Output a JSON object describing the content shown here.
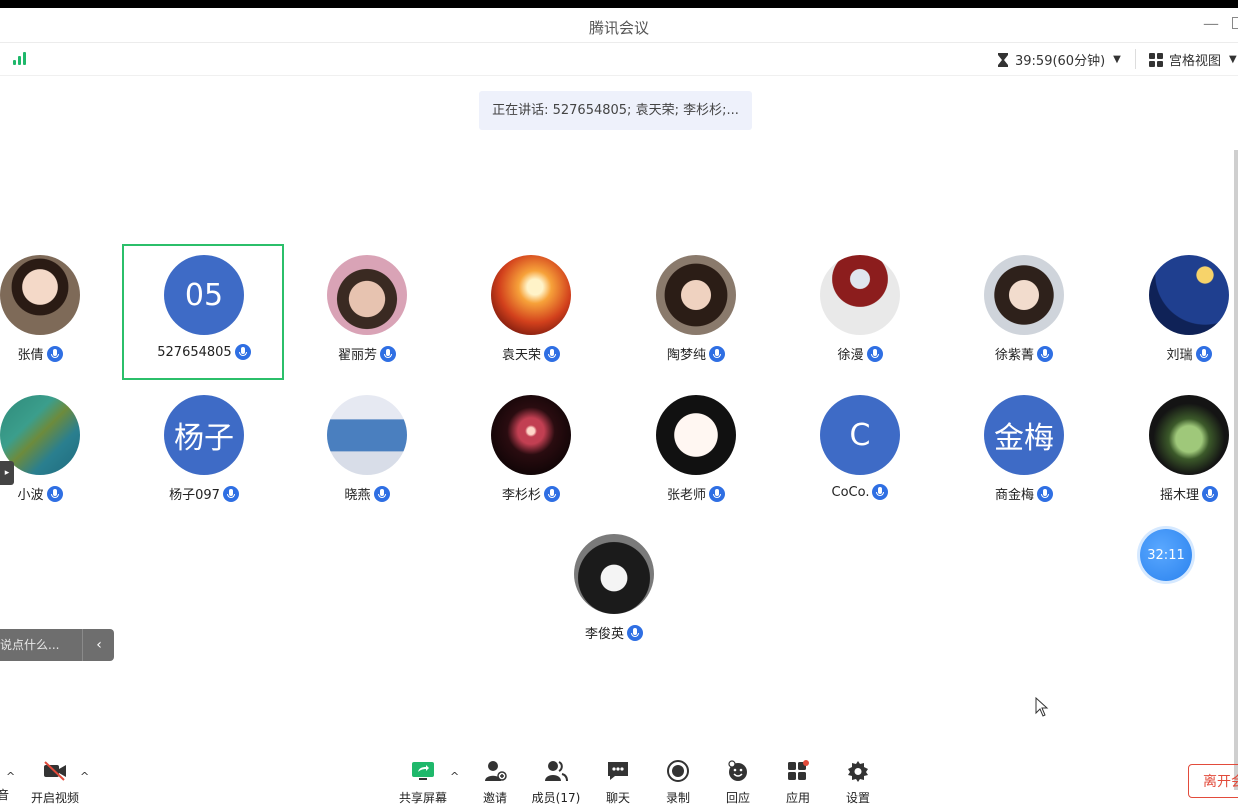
{
  "window": {
    "title": "腾讯会议"
  },
  "toolbar": {
    "timer": "39:59(60分钟)",
    "view_label": "宫格视图"
  },
  "speaking_banner": "正在讲话: 527654805; 袁天荣; 李杉杉;...",
  "participants": [
    {
      "name": "张倩",
      "avatar": "photo"
    },
    {
      "name": "527654805",
      "avatar": "initials",
      "initials": "05",
      "active": true
    },
    {
      "name": "翟丽芳",
      "avatar": "photo"
    },
    {
      "name": "袁天荣",
      "avatar": "photo"
    },
    {
      "name": "陶梦纯",
      "avatar": "photo"
    },
    {
      "name": "徐漫",
      "avatar": "photo"
    },
    {
      "name": "徐紫菁",
      "avatar": "photo"
    },
    {
      "name": "刘瑞",
      "avatar": "photo"
    },
    {
      "name": "小波",
      "avatar": "photo"
    },
    {
      "name": "杨子097",
      "avatar": "initials",
      "initials": "杨子"
    },
    {
      "name": "晓燕",
      "avatar": "photo"
    },
    {
      "name": "李杉杉",
      "avatar": "photo"
    },
    {
      "name": "张老师",
      "avatar": "photo"
    },
    {
      "name": "CoCo.",
      "avatar": "initials",
      "initials": "C"
    },
    {
      "name": "商金梅",
      "avatar": "initials",
      "initials": "金梅"
    },
    {
      "name": "摇木理",
      "avatar": "photo"
    },
    {
      "name": "李俊英",
      "avatar": "photo"
    }
  ],
  "float_timer": "32:11",
  "chat": {
    "placeholder": "说点什么..."
  },
  "bottom": {
    "mute_label": "音",
    "video_label": "开启视频",
    "share_label": "共享屏幕",
    "invite_label": "邀请",
    "members_label": "成员(17)",
    "chat_label": "聊天",
    "record_label": "录制",
    "react_label": "回应",
    "apps_label": "应用",
    "settings_label": "设置",
    "leave_label": "离开会议"
  },
  "colors": {
    "accent": "#2f6fe3",
    "active_border": "#2bbf6a",
    "initials_bg": "#3e6bc6",
    "leave": "#e24b3b"
  }
}
